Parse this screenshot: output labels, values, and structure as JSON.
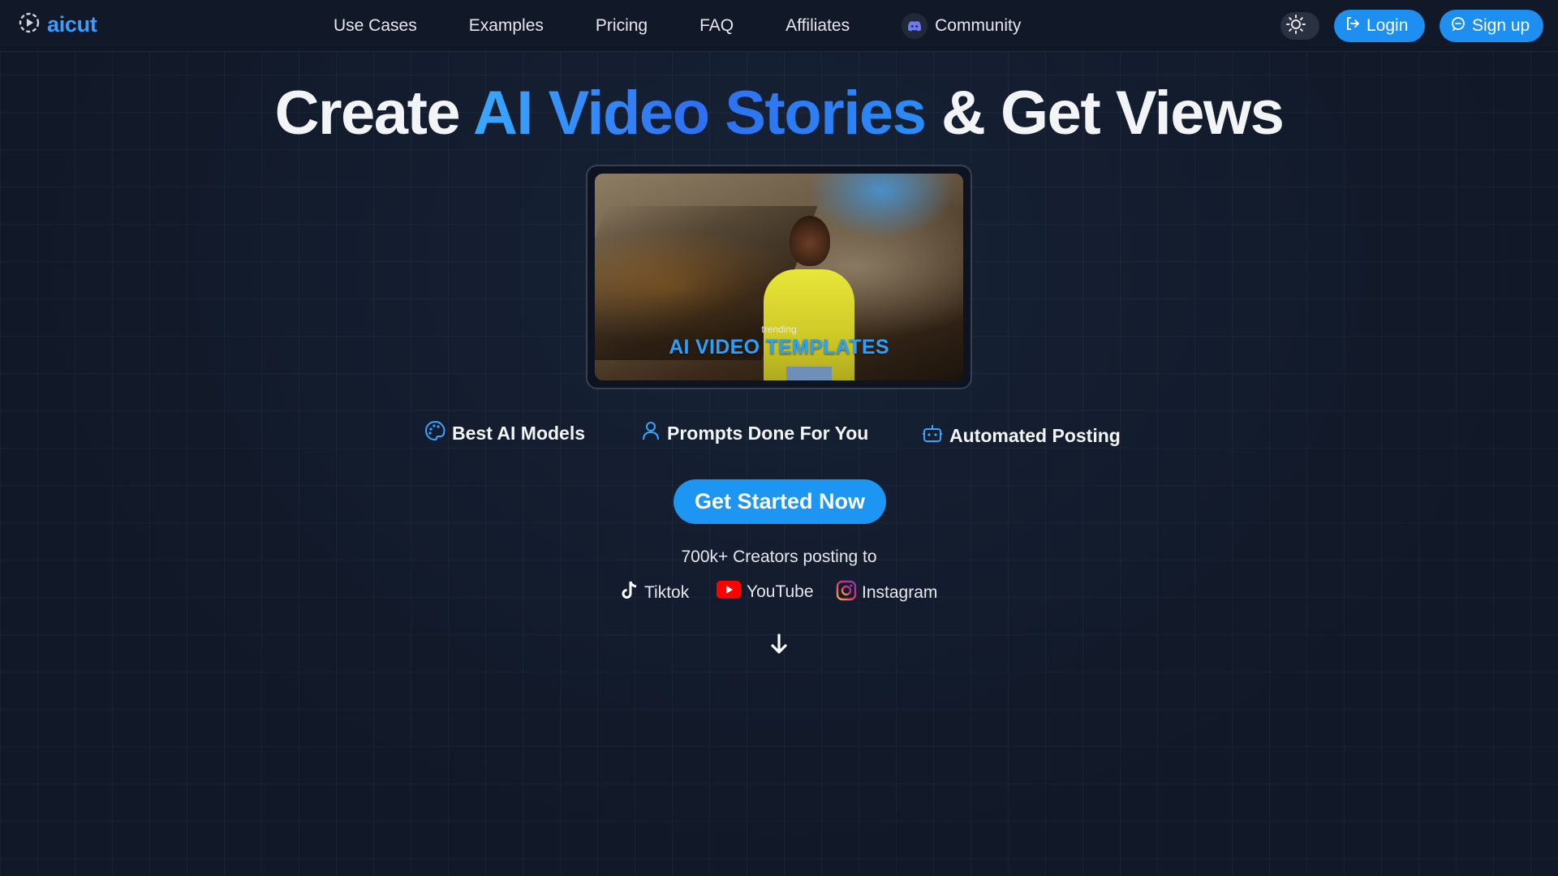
{
  "nav": {
    "logo_text": "aicut",
    "links": [
      {
        "label": "Use Cases"
      },
      {
        "label": "Examples"
      },
      {
        "label": "Pricing"
      },
      {
        "label": "FAQ"
      },
      {
        "label": "Affiliates"
      },
      {
        "label": "Community",
        "icon": "discord-icon"
      }
    ],
    "theme_toggle_icon": "sun-icon",
    "login_label": "Login",
    "signup_label": "Sign up"
  },
  "hero": {
    "title_part1": "Create ",
    "title_highlight": "AI Video Stories",
    "title_part2": " & Get Views",
    "video": {
      "small_caption": "trending",
      "big_caption": "AI VIDEO TEMPLATES"
    }
  },
  "features": [
    {
      "label": "Best AI Models",
      "icon": "palette-icon"
    },
    {
      "label": "Prompts Done For You",
      "icon": "user-icon"
    },
    {
      "label": "Automated Posting",
      "icon": "robot-icon"
    }
  ],
  "cta_label": "Get Started Now",
  "creators_text": "700k+ Creators posting to",
  "platforms": [
    {
      "label": "Tiktok",
      "icon": "tiktok-icon"
    },
    {
      "label": "YouTube",
      "icon": "youtube-icon"
    },
    {
      "label": "Instagram",
      "icon": "instagram-icon"
    }
  ],
  "colors": {
    "accent": "#1d95f2",
    "background": "#121a28",
    "brand_blue": "#3b9eff"
  }
}
